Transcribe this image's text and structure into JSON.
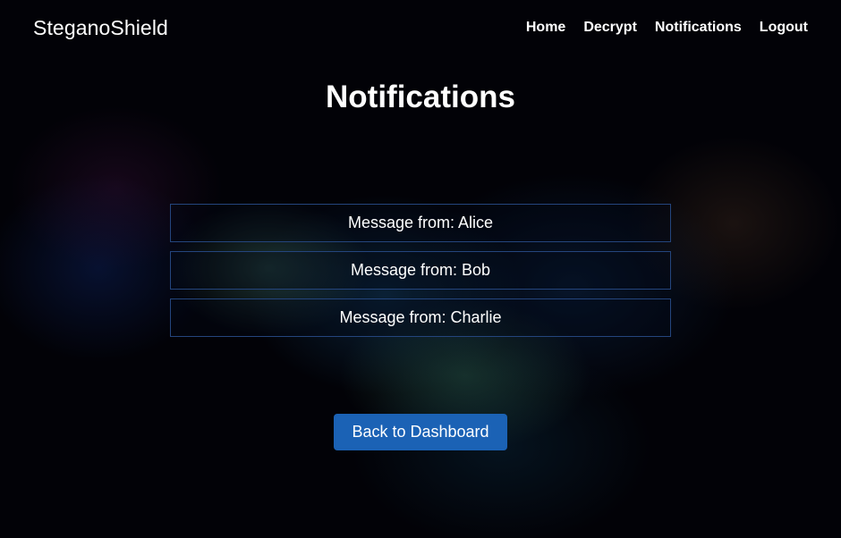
{
  "navbar": {
    "brand": "SteganoShield",
    "links": [
      {
        "label": "Home"
      },
      {
        "label": "Decrypt"
      },
      {
        "label": "Notifications"
      },
      {
        "label": "Logout"
      }
    ]
  },
  "main": {
    "title": "Notifications",
    "notifications": [
      {
        "text": "Message from: Alice"
      },
      {
        "text": "Message from: Bob"
      },
      {
        "text": "Message from: Charlie"
      }
    ],
    "back_button_label": "Back to Dashboard"
  },
  "colors": {
    "background": "#020207",
    "accent_button": "#1b62b5",
    "item_border": "#24457d",
    "text": "#ffffff"
  }
}
